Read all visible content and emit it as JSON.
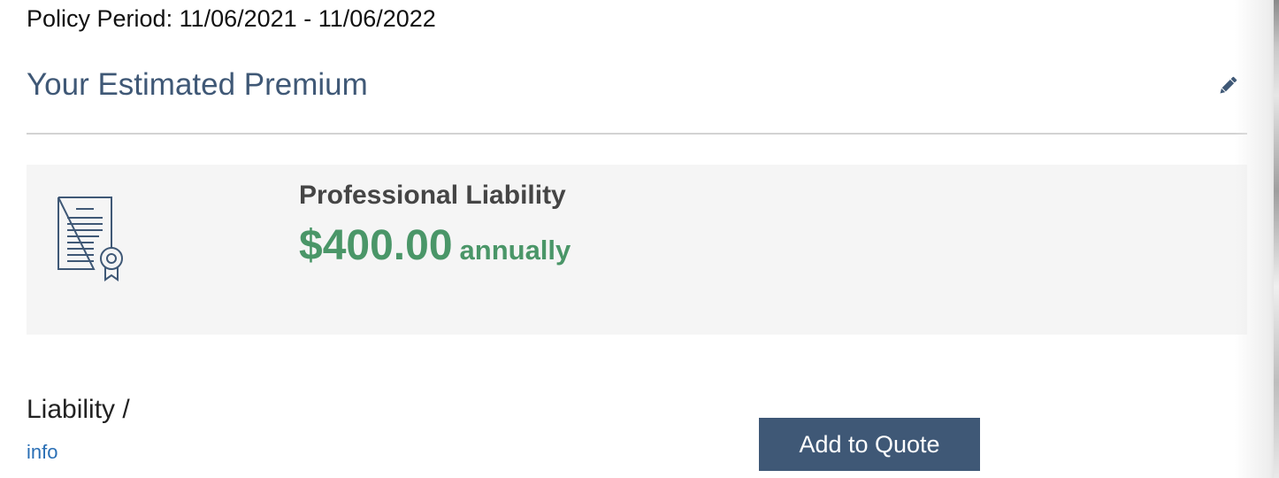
{
  "policy": {
    "period_text": "Policy Period: 11/06/2021 - 11/06/2022"
  },
  "premium_section": {
    "title": "Your Estimated Premium",
    "edit_icon": "pencil-icon"
  },
  "premium_card": {
    "icon": "certificate-document-icon",
    "coverage_name": "Professional Liability",
    "price": "$400.00",
    "period": "annually"
  },
  "liability": {
    "label": "Liability /",
    "info_link": "info",
    "add_button_label": "Add to Quote"
  },
  "colors": {
    "title_blue": "#3f5876",
    "price_green": "#4a9668",
    "link_blue": "#2a6fb5",
    "card_bg": "#f5f5f5",
    "button_bg": "#3f5876"
  }
}
